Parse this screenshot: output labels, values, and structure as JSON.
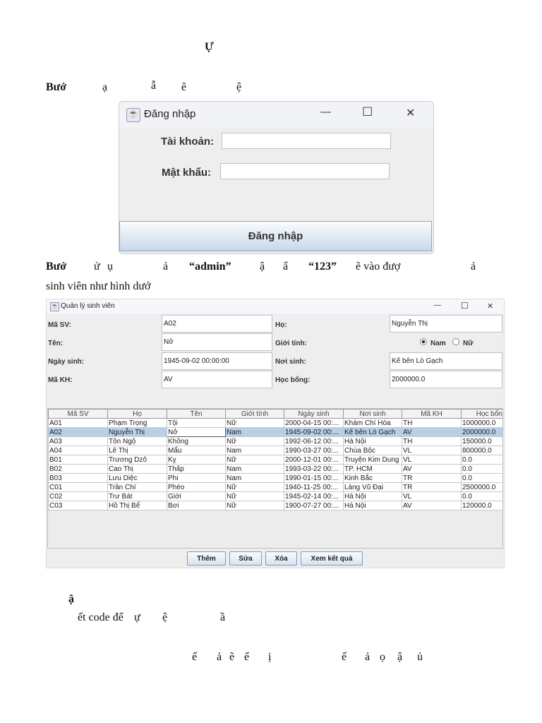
{
  "doc": {
    "heading_fragment": "Ự",
    "step1": {
      "label": "Bướ",
      "frags": [
        "ạ",
        "ẫ",
        "ẽ",
        "ệ"
      ]
    },
    "step2": {
      "label": "Bướ",
      "frags": [
        "ử",
        "ụ",
        "ả",
        "“admin”",
        "ậ",
        "ẩ",
        "“123”",
        "ẽ vào đượ",
        "ả"
      ],
      "line2": "sinh viên như hình dướ"
    },
    "section_fragment": "ậ",
    "line_code": "ết code để",
    "line_code_frags": [
      "ự",
      "ệ",
      "ầ"
    ],
    "last_line_frags": [
      "ế",
      "ả",
      "ẽ",
      "ể",
      "ị",
      "ế",
      "ả",
      "ọ",
      "ậ",
      "ủ"
    ]
  },
  "login": {
    "title": "Đăng nhập",
    "username_label": "Tài khoản:",
    "username_value": "",
    "password_label": "Mật khẩu:",
    "password_value": "",
    "submit_label": "Đăng nhập",
    "controls": {
      "minimize": "—",
      "maximize": "☐",
      "close": "✕"
    }
  },
  "student": {
    "title": "Quản lý sinh viên",
    "fields": {
      "ma_sv": {
        "label": "Mã SV:",
        "value": "A02"
      },
      "ho": {
        "label": "Họ:",
        "value": "Nguyễn Thị"
      },
      "ten": {
        "label": "Tên:",
        "value": "Nở"
      },
      "gioi_tinh": {
        "label": "Giới tính:",
        "options": [
          "Nam",
          "Nữ"
        ],
        "selected": "Nam"
      },
      "ngay_sinh": {
        "label": "Ngày sinh:",
        "value": "1945-09-02 00:00:00"
      },
      "noi_sinh": {
        "label": "Nơi sinh:",
        "value": "Kế bên Lò Gạch"
      },
      "ma_kh": {
        "label": "Mã KH:",
        "value": "AV"
      },
      "hoc_bong": {
        "label": "Học bổng:",
        "value": "2000000.0"
      }
    },
    "columns": [
      "Mã SV",
      "Họ",
      "Tên",
      "Giới tính",
      "Ngày sinh",
      "Nơi sinh",
      "Mã KH",
      "Học bổng"
    ],
    "selected_row": 1,
    "rows": [
      [
        "A01",
        "Phạm Trọng",
        "Tội",
        "Nữ",
        "2000-04-15 00:...",
        "Khám Chí Hòa",
        "TH",
        "1000000.0"
      ],
      [
        "A02",
        "Nguyễn Thị",
        "Nở",
        "Nam",
        "1945-09-02 00:...",
        "Kế bên Lò Gạch",
        "AV",
        "2000000.0"
      ],
      [
        "A03",
        "Tôn Ngộ",
        "Không",
        "Nữ",
        "1992-06-12 00:...",
        "Hà Nội",
        "TH",
        "150000.0"
      ],
      [
        "A04",
        "Lê Thị",
        "Mẩu",
        "Nam",
        "1990-03-27 00:...",
        "Chùa Bộc",
        "VL",
        "800000.0"
      ],
      [
        "B01",
        "Trương Dzô",
        "Kỵ",
        "Nữ",
        "2000-12-01 00:...",
        "Truyện Kim Dung",
        "VL",
        "0.0"
      ],
      [
        "B02",
        "Cao Thị",
        "Thấp",
        "Nam",
        "1993-03-22 00:...",
        "TP. HCM",
        "AV",
        "0.0"
      ],
      [
        "B03",
        "Lưu Diệc",
        "Phi",
        "Nam",
        "1990-01-15 00:...",
        "Kinh Bắc",
        "TR",
        "0.0"
      ],
      [
        "C01",
        "Trần Chí",
        "Phèo",
        "Nữ",
        "1940-11-25 00:...",
        "Làng Vũ Đại",
        "TR",
        "2500000.0"
      ],
      [
        "C02",
        "Trư Bát",
        "Giới",
        "Nữ",
        "1945-02-14 00:...",
        "Hà Nội",
        "VL",
        "0.0"
      ],
      [
        "C03",
        "Hồ Thị Bể",
        "Bơi",
        "Nữ",
        "1900-07-27 00:...",
        "Hà Nội",
        "AV",
        "120000.0"
      ]
    ],
    "buttons": [
      "Thêm",
      "Sửa",
      "Xóa",
      "Xem kết quả"
    ]
  }
}
